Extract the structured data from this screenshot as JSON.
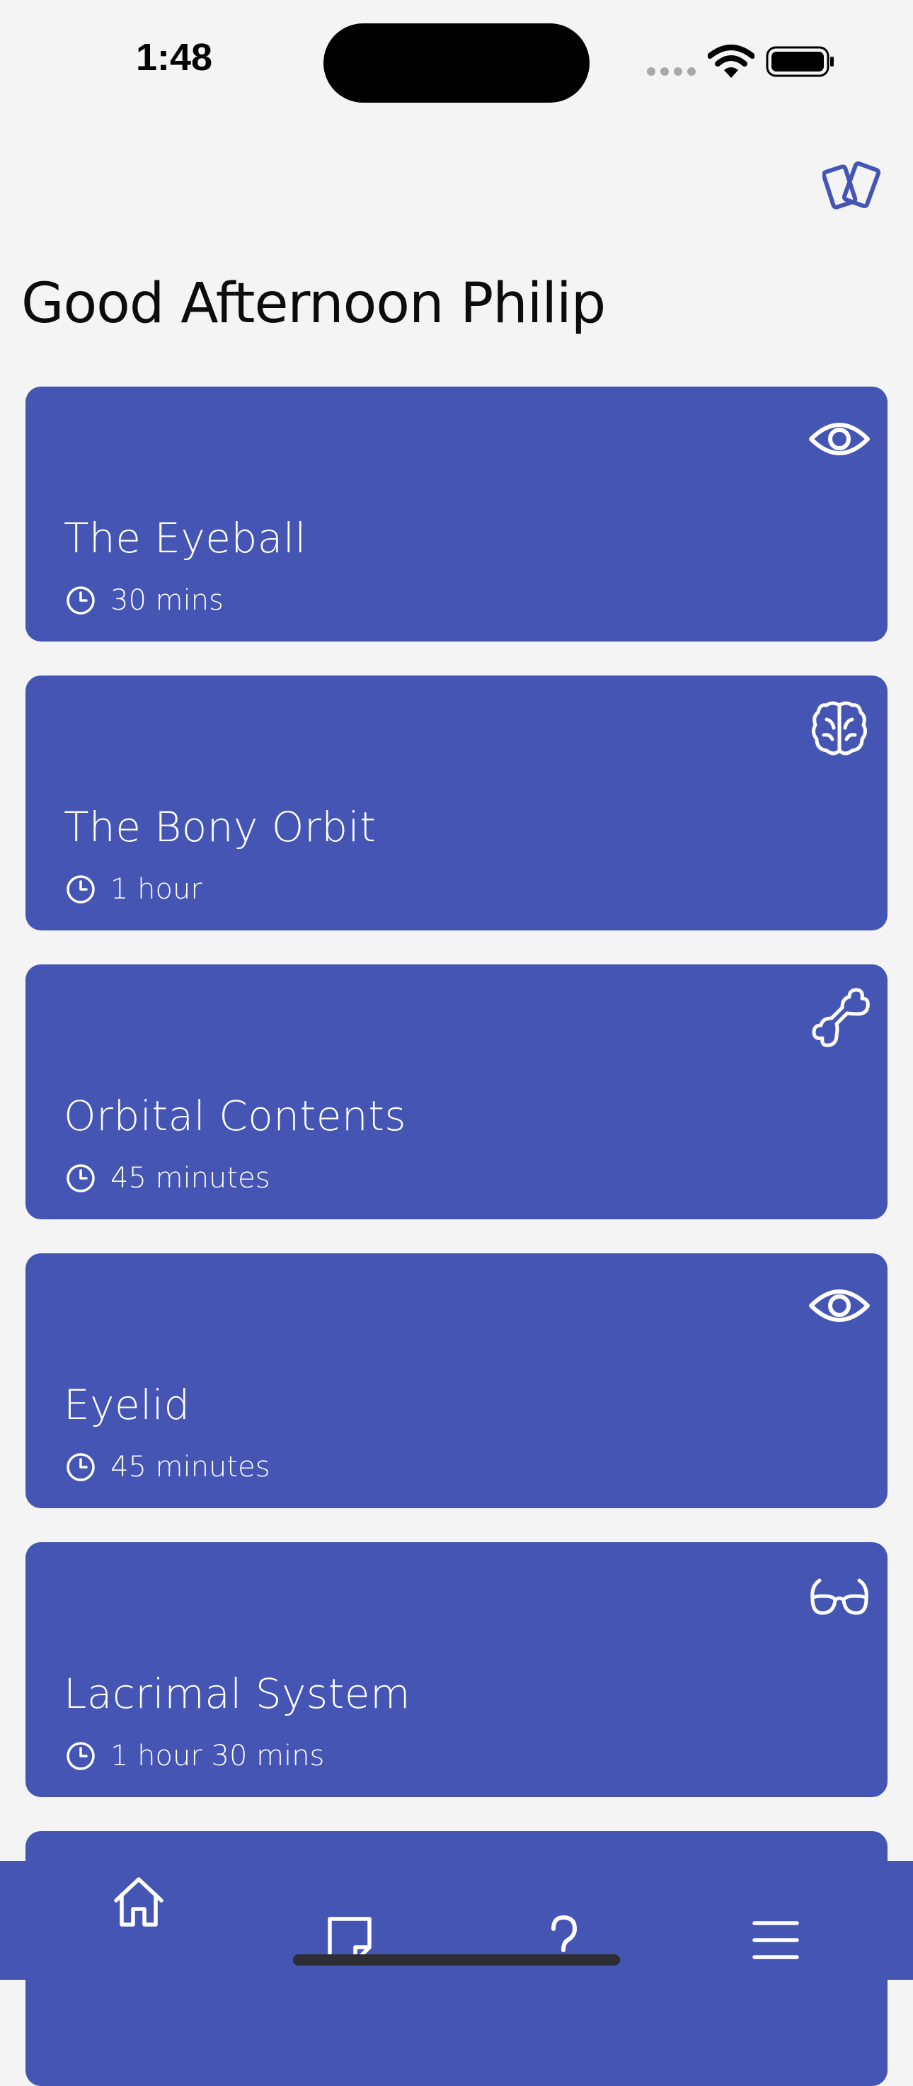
{
  "status_bar": {
    "time": "1:48"
  },
  "header": {
    "action_icon": "flashcards-icon"
  },
  "greeting": "Good Afternoon Philip",
  "cards": [
    {
      "title": "The Eyeball",
      "duration": "30 mins",
      "icon": "eye-icon"
    },
    {
      "title": "The Bony Orbit",
      "duration": "1 hour",
      "icon": "brain-icon"
    },
    {
      "title": "Orbital Contents",
      "duration": "45 minutes",
      "icon": "bone-icon"
    },
    {
      "title": "Eyelid",
      "duration": "45 minutes",
      "icon": "eye-icon"
    },
    {
      "title": "Lacrimal System",
      "duration": "1 hour 30 mins",
      "icon": "glasses-icon"
    }
  ],
  "bottom_nav": [
    {
      "icon": "home-icon",
      "active": true
    },
    {
      "icon": "note-icon",
      "active": false
    },
    {
      "icon": "question-icon",
      "active": false
    },
    {
      "icon": "menu-icon",
      "active": false
    }
  ],
  "colors": {
    "accent": "#4455b4",
    "background": "#f4f4f4",
    "text": "#0c0c0c",
    "on_accent": "#ffffff"
  }
}
